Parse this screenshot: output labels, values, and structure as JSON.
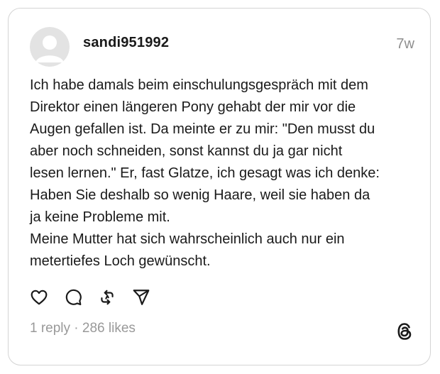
{
  "post": {
    "username": "sandi951992",
    "time": "7w",
    "text_lines": [
      "Ich habe damals beim einschulungsgespräch mit dem",
      "Direktor einen längeren Pony gehabt der mir vor die",
      "Augen gefallen ist. Da meinte er zu mir: \"Den musst du",
      "aber noch schneiden, sonst kannst du ja gar nicht",
      "lesen lernen.\" Er, fast Glatze, ich gesagt was ich denke:",
      "Haben Sie deshalb so wenig Haare, weil sie haben da",
      "ja keine Probleme mit.",
      "Meine Mutter hat sich wahrscheinlich auch nur ein",
      "metertiefes Loch gewünscht."
    ],
    "stats": {
      "replies": "1 reply",
      "separator": " · ",
      "likes": "286 likes"
    }
  },
  "icons": {
    "avatar": "default-avatar-icon",
    "like": "heart-icon",
    "reply": "comment-bubble-icon",
    "repost": "repost-icon",
    "share": "send-icon",
    "brand": "threads-logo-icon"
  },
  "colors": {
    "text": "#1a1a1a",
    "muted": "#8e8e8e",
    "border": "#d4d4d4",
    "avatar_bg": "#d9d9d9"
  }
}
